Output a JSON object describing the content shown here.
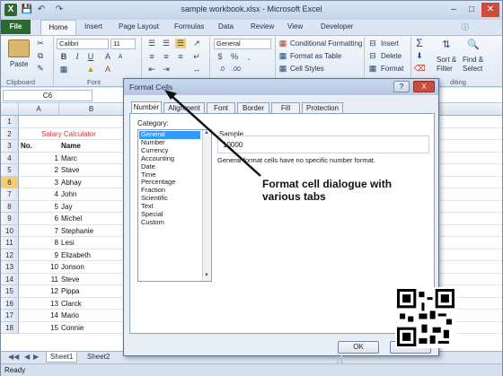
{
  "window": {
    "title": "sample workbook.xlsx - Microsoft Excel"
  },
  "ribbon": {
    "tabs": [
      "File",
      "Home",
      "Insert",
      "Page Layout",
      "Formulas",
      "Data",
      "Review",
      "View",
      "Developer"
    ],
    "font_name": "Calibri",
    "font_size": "11",
    "number_format": "General",
    "paste_label": "Paste",
    "buttons": {
      "conditional_formatting": "Conditional Formatting",
      "format_as_table": "Format as Table",
      "cell_styles": "Cell Styles",
      "insert": "Insert",
      "delete": "Delete",
      "format": "Format",
      "sort_filter": "Sort &",
      "filter": "Filter",
      "find_select": "Find &",
      "select": "Select"
    },
    "groups": {
      "clipboard": "Clipboard",
      "font": "Font",
      "editing": "diting"
    }
  },
  "name_box": "C6",
  "columns": [
    "A",
    "B"
  ],
  "sheet": {
    "title": "Salary Calculator",
    "header_no": "No.",
    "header_name": "Name",
    "rows": [
      {
        "row": "1",
        "no": "",
        "name": ""
      },
      {
        "row": "2",
        "no": "",
        "name": ""
      },
      {
        "row": "3",
        "no": "No.",
        "name": "Name"
      },
      {
        "row": "4",
        "no": "1",
        "name": "Marc"
      },
      {
        "row": "5",
        "no": "2",
        "name": "Stave"
      },
      {
        "row": "6",
        "no": "3",
        "name": "Abhay"
      },
      {
        "row": "7",
        "no": "4",
        "name": "John"
      },
      {
        "row": "8",
        "no": "5",
        "name": "Jay"
      },
      {
        "row": "9",
        "no": "6",
        "name": "Michel"
      },
      {
        "row": "10",
        "no": "7",
        "name": "Stephanie"
      },
      {
        "row": "11",
        "no": "8",
        "name": "Lesi"
      },
      {
        "row": "12",
        "no": "9",
        "name": "Elizabeth"
      },
      {
        "row": "13",
        "no": "10",
        "name": "Jonson"
      },
      {
        "row": "14",
        "no": "11",
        "name": "Steve"
      },
      {
        "row": "15",
        "no": "12",
        "name": "Pippa"
      },
      {
        "row": "16",
        "no": "13",
        "name": "Clarck"
      },
      {
        "row": "17",
        "no": "14",
        "name": "Mario"
      },
      {
        "row": "18",
        "no": "15",
        "name": "Connie"
      }
    ]
  },
  "sheet_tabs": [
    "Sheet1",
    "Sheet2"
  ],
  "status": "Ready",
  "dialog": {
    "title": "Format Cells",
    "help": "?",
    "close": "X",
    "tabs": [
      "Number",
      "Alignment",
      "Font",
      "Border",
      "Fill",
      "Protection"
    ],
    "category_label": "Category:",
    "categories": [
      "General",
      "Number",
      "Currency",
      "Accounting",
      "Date",
      "Time",
      "Percentage",
      "Fraction",
      "Scientific",
      "Text",
      "Special",
      "Custom"
    ],
    "sample_label": "Sample",
    "sample_value": "10000",
    "description": "General format cells have no specific number format.",
    "ok": "OK"
  },
  "annotation": "Format cell dialogue with various tabs",
  "watermark": "it"
}
